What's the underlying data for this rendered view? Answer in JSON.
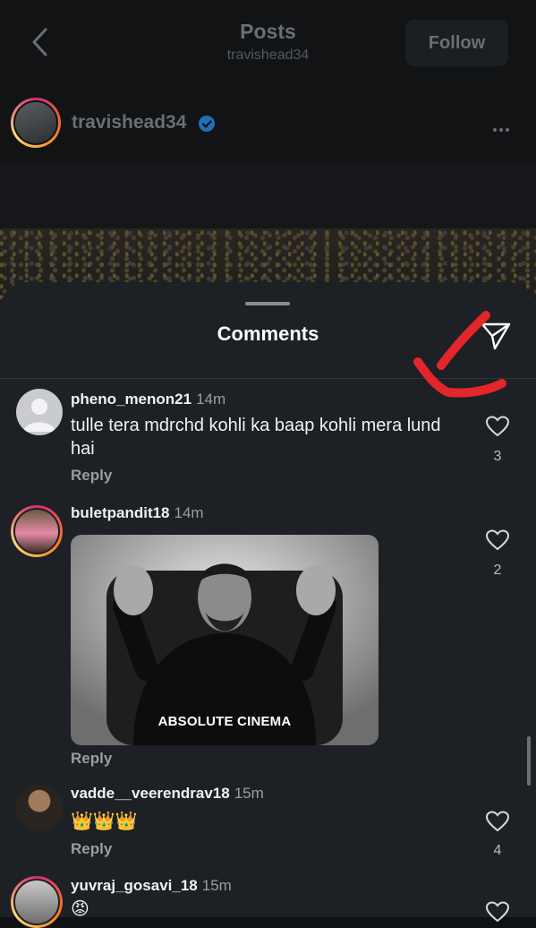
{
  "header": {
    "title": "Posts",
    "subtitle": "travishead34",
    "follow_label": "Follow"
  },
  "post": {
    "owner_username": "travishead34",
    "verified": true
  },
  "comments_sheet": {
    "title": "Comments",
    "comments": [
      {
        "username": "pheno_menon21",
        "time": "14m",
        "text": "tulle tera mdrchd kohli ka baap kohli mera lund hai",
        "reply_label": "Reply",
        "likes": "3"
      },
      {
        "username": "buletpandit18",
        "time": "14m",
        "gif_caption": "ABSOLUTE CINEMA",
        "reply_label": "Reply",
        "likes": "2"
      },
      {
        "username": "vadde__veerendrav18",
        "time": "15m",
        "text": "👑👑👑",
        "reply_label": "Reply",
        "likes": "4"
      },
      {
        "username": "yuvraj_gosavi_18",
        "time": "15m",
        "text": "😡"
      }
    ]
  },
  "icons": {
    "back": "chevron-left-icon",
    "verified": "verified-badge-icon",
    "more": "more-horizontal-icon",
    "share": "paper-plane-icon",
    "like": "heart-icon"
  },
  "colors": {
    "sheet_bg": "#1d2024",
    "annotation": "#e3262b",
    "verified": "#1d9bf0"
  }
}
